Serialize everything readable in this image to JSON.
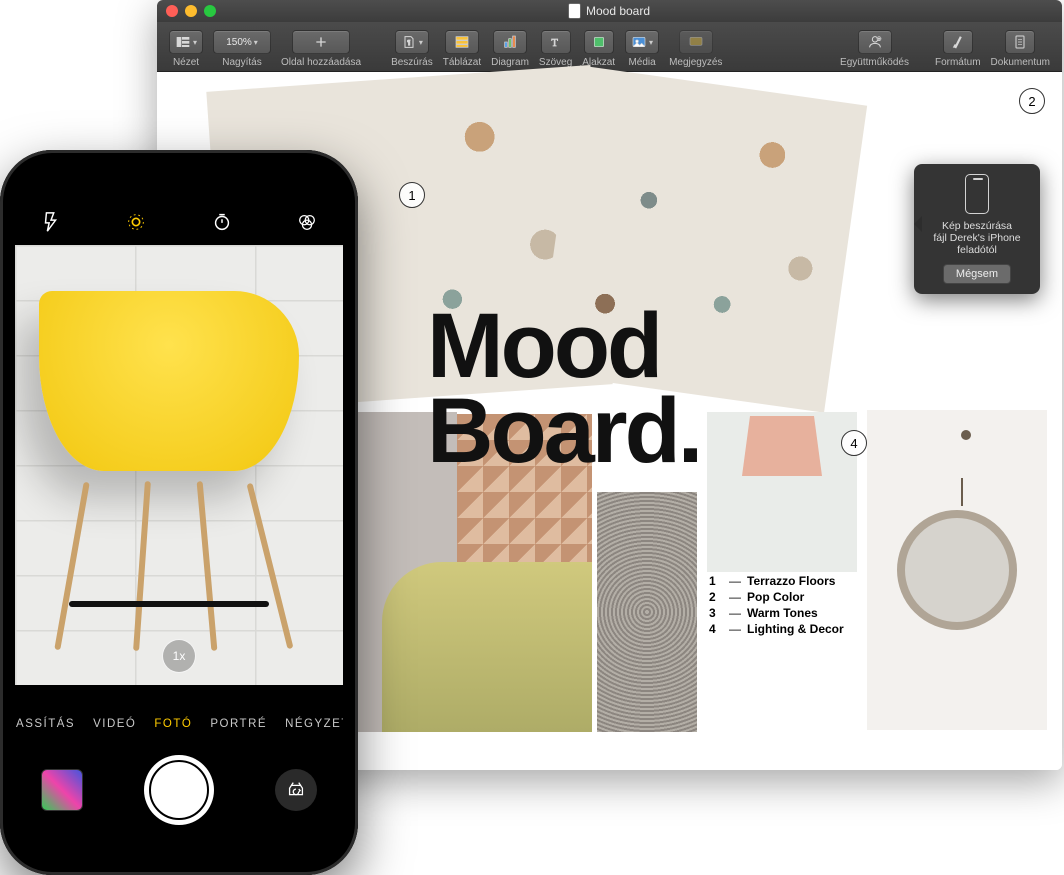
{
  "mac": {
    "windowTitle": "Mood board",
    "toolbar": {
      "view": "Nézet",
      "zoom": "Nagyítás",
      "zoomValue": "150%",
      "addPage": "Oldal hozzáadása",
      "insert": "Beszúrás",
      "table": "Táblázat",
      "chart": "Diagram",
      "text": "Szöveg",
      "shape": "Alakzat",
      "media": "Média",
      "comment": "Megjegyzés",
      "collab": "Együttműködés",
      "format": "Formátum",
      "document": "Dokumentum"
    },
    "document": {
      "title1": "Mood",
      "title2": "Board.",
      "markers": {
        "m1": "1",
        "m2": "2",
        "m4": "4"
      },
      "legend": [
        {
          "n": "1",
          "t": "Terrazzo Floors"
        },
        {
          "n": "2",
          "t": "Pop Color"
        },
        {
          "n": "3",
          "t": "Warm Tones"
        },
        {
          "n": "4",
          "t": "Lighting & Decor"
        }
      ]
    },
    "popover": {
      "line1": "Kép beszúrása",
      "line2": "fájl Derek's iPhone",
      "line3": "feladótól",
      "cancel": "Mégsem"
    }
  },
  "iphone": {
    "zoom": "1x",
    "modes": {
      "slomo": "LASSÍTÁS",
      "video": "VIDEÓ",
      "photo": "FOTÓ",
      "portrait": "PORTRÉ",
      "square": "NÉGYZET"
    }
  }
}
